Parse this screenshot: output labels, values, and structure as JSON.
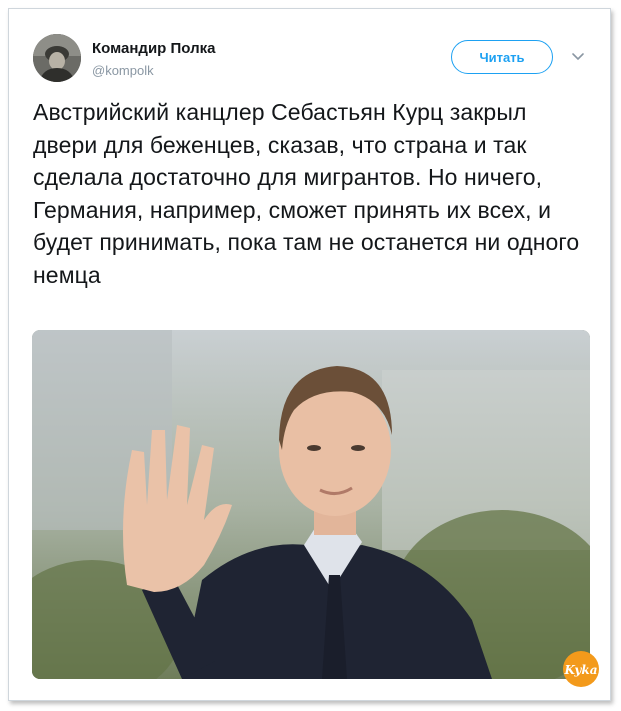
{
  "tweet": {
    "author_name": "Командир Полка",
    "author_handle": "@kompolk",
    "follow_label": "Читать",
    "text": "Австрийский канцлер Себастьян Курц закрыл двери для беженцев, сказав, что страна и так сделала достаточно для мигрантов. Но ничего, Германия, например, сможет принять их всех, и будет принимать, пока там не останется ни одного немца"
  },
  "watermark": {
    "text": "Kyka",
    "color": "#f39a1b"
  },
  "colors": {
    "accent": "#1da1f2",
    "text": "#14171a",
    "muted": "#8a97a3"
  },
  "icons": {
    "menu": "chevron-down-icon"
  }
}
